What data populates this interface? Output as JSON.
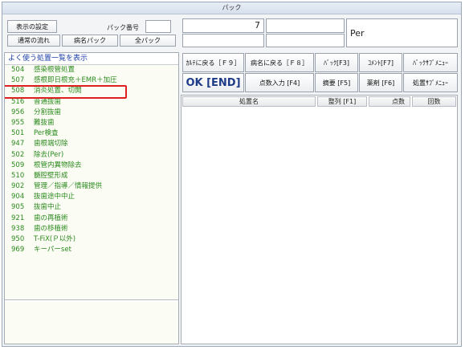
{
  "window": {
    "title": "パック"
  },
  "top_left": {
    "display_settings": "表示の設定",
    "pack_number_label": "パック番号",
    "normal_flow": "通常の流れ",
    "disease_pack": "病名パック",
    "all_pack": "全パック"
  },
  "top_right": {
    "count_value": "7",
    "per_text": "Per"
  },
  "toolbar": {
    "row1": [
      "ｶﾙﾃに戻る［Ｆ９］",
      "病名に戻る［Ｆ８］",
      "ﾊﾞｯｸ[F3]",
      "ｺﾒﾝﾄ[F7]",
      "ﾊﾞｯｸｻﾌﾞﾒﾆｭｰ"
    ],
    "ok_label": "OK [END]",
    "row2": [
      "点数入力 [F4]",
      "摘要 [F5]",
      "薬剤 [F6]",
      "処置ｻﾌﾞﾒﾆｭｰ"
    ]
  },
  "list": {
    "header": "よく使う処置一覧を表示",
    "items": [
      {
        "code": "504",
        "name": "感染根管処置"
      },
      {
        "code": "507",
        "name": "感根即日根充＋EMR＋加圧"
      },
      {
        "code": "508",
        "name": "消炎処置、切開"
      },
      {
        "code": "516",
        "name": "普通抜歯"
      },
      {
        "code": "956",
        "name": "分割抜歯"
      },
      {
        "code": "955",
        "name": "難抜歯"
      },
      {
        "code": "501",
        "name": "Per検査"
      },
      {
        "code": "947",
        "name": "歯根端切除"
      },
      {
        "code": "502",
        "name": "除去(Per)"
      },
      {
        "code": "509",
        "name": "根管内異物除去"
      },
      {
        "code": "510",
        "name": "髄腔壁形成"
      },
      {
        "code": "902",
        "name": "管理／指導／情報提供"
      },
      {
        "code": "904",
        "name": "抜歯途中中止"
      },
      {
        "code": "905",
        "name": "抜歯中止"
      },
      {
        "code": "921",
        "name": "歯の再植術"
      },
      {
        "code": "938",
        "name": "歯の移植術"
      },
      {
        "code": "950",
        "name": "T-FiX(Ｐ以外)"
      },
      {
        "code": "969",
        "name": "キーパーset"
      }
    ]
  },
  "table": {
    "columns": [
      "処置名",
      "整列 [F1]",
      "点数",
      "回数"
    ]
  },
  "colors": {
    "highlight": "#e02020",
    "item_text": "#2b8a1f",
    "ok_text": "#1f3c88"
  }
}
